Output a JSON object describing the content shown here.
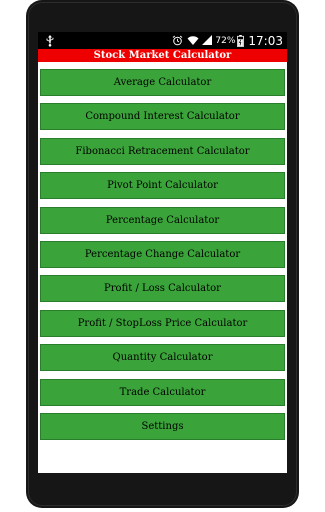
{
  "status_bar": {
    "battery_percent": "72%",
    "time": "17:03"
  },
  "app": {
    "title": "Stock Market Calculator"
  },
  "menu": {
    "items": [
      {
        "label": "Average Calculator"
      },
      {
        "label": "Compound Interest Calculator"
      },
      {
        "label": "Fibonacci Retracement Calculator"
      },
      {
        "label": "Pivot Point Calculator"
      },
      {
        "label": "Percentage Calculator"
      },
      {
        "label": "Percentage Change Calculator"
      },
      {
        "label": "Profit / Loss Calculator"
      },
      {
        "label": "Profit / StopLoss Price Calculator"
      },
      {
        "label": "Quantity Calculator"
      },
      {
        "label": "Trade Calculator"
      },
      {
        "label": "Settings"
      }
    ]
  },
  "colors": {
    "title_bar": "#ee0000",
    "button": "#3aa33a",
    "status_bar": "#000000"
  }
}
